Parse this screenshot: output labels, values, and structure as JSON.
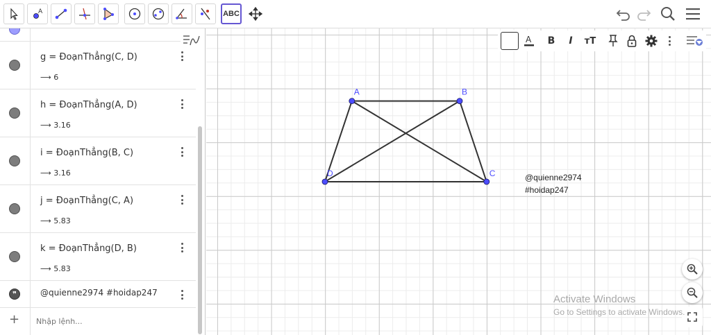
{
  "toolbar": {
    "tools": [
      {
        "name": "move-tool-icon"
      },
      {
        "name": "point-tool-icon"
      },
      {
        "name": "line-tool-icon"
      },
      {
        "name": "perpendicular-line-tool-icon"
      },
      {
        "name": "polygon-tool-icon"
      },
      {
        "name": "circle-tool-icon"
      },
      {
        "name": "ellipse-tool-icon"
      },
      {
        "name": "angle-tool-icon"
      },
      {
        "name": "reflect-tool-icon"
      },
      {
        "name": "text-tool-icon"
      },
      {
        "name": "move-graphics-view-tool-icon"
      }
    ],
    "text_tool_label": "ABC",
    "accent_color": "#6557d2"
  },
  "algebra": {
    "rows": [
      {
        "definition": "g = ĐoạnThẳng(C, D)",
        "value": "⟶ 6"
      },
      {
        "definition": "h = ĐoạnThẳng(A, D)",
        "value": "⟶ 3.16"
      },
      {
        "definition": "i = ĐoạnThẳng(B, C)",
        "value": "⟶ 3.16"
      },
      {
        "definition": "j = ĐoạnThẳng(C, A)",
        "value": "⟶ 5.83"
      },
      {
        "definition": "k = ĐoạnThẳng(D, B)",
        "value": "⟶ 5.83"
      }
    ],
    "text_row": "@quienne2974 #hoidap247",
    "input_placeholder": "Nhập lệnh..."
  },
  "graphics": {
    "points": [
      {
        "label": "A",
        "x": 1,
        "y": 3
      },
      {
        "label": "B",
        "x": 5,
        "y": 3
      },
      {
        "label": "C",
        "x": 6,
        "y": 0
      },
      {
        "label": "D",
        "x": 0,
        "y": 0
      }
    ],
    "segments": [
      [
        "A",
        "B"
      ],
      [
        "B",
        "C"
      ],
      [
        "C",
        "D"
      ],
      [
        "D",
        "A"
      ],
      [
        "C",
        "A"
      ],
      [
        "D",
        "B"
      ]
    ],
    "point_color": "#4d4dff",
    "label_color": "#4d4dff",
    "segment_color": "#333333",
    "text_line_1": "@quienne2974",
    "text_line_2": "#hoidap247"
  },
  "stylebar": {
    "bold_label": "B",
    "italic_label": "I",
    "size_label": "ᴛT"
  },
  "windows_watermark": {
    "title": "Activate Windows",
    "subtitle": "Go to Settings to activate Windows."
  }
}
